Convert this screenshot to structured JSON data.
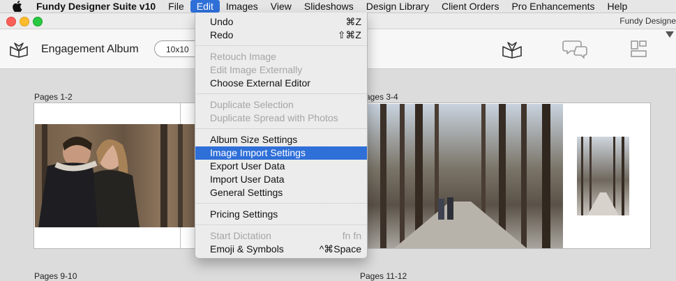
{
  "menubar": {
    "app_name": "Fundy Designer Suite v10",
    "items": [
      "File",
      "Edit",
      "Images",
      "View",
      "Slideshows",
      "Design Library",
      "Client Orders",
      "Pro Enhancements",
      "Help"
    ],
    "active": "Edit"
  },
  "window": {
    "title": "Fundy Designe"
  },
  "toolbar": {
    "album_title": "Engagement Album",
    "size_value": "10x10",
    "icons": [
      "album-book-icon",
      "chat-bubbles-icon",
      "layout-icon"
    ]
  },
  "spreads": {
    "s1": {
      "label": "Pages 1-2"
    },
    "s2": {
      "label": "Pages 3-4"
    },
    "s3": {
      "label": "Pages 9-10"
    },
    "s4": {
      "label": "Pages 11-12"
    }
  },
  "edit_menu": {
    "items": [
      {
        "label": "Undo",
        "shortcut": "⌘Z",
        "enabled": true
      },
      {
        "label": "Redo",
        "shortcut": "⇧⌘Z",
        "enabled": true
      },
      {
        "label": "Retouch Image",
        "shortcut": "",
        "enabled": false
      },
      {
        "label": "Edit Image Externally",
        "shortcut": "",
        "enabled": false
      },
      {
        "label": "Choose External Editor",
        "shortcut": "",
        "enabled": true
      },
      {
        "label": "Duplicate Selection",
        "shortcut": "",
        "enabled": false
      },
      {
        "label": "Duplicate Spread with Photos",
        "shortcut": "",
        "enabled": false
      },
      {
        "label": "Album Size Settings",
        "shortcut": "",
        "enabled": true
      },
      {
        "label": "Image Import Settings",
        "shortcut": "",
        "enabled": true,
        "selected": true
      },
      {
        "label": "Export User Data",
        "shortcut": "",
        "enabled": true
      },
      {
        "label": "Import User Data",
        "shortcut": "",
        "enabled": true
      },
      {
        "label": "General Settings",
        "shortcut": "",
        "enabled": true
      },
      {
        "label": "Pricing Settings",
        "shortcut": "",
        "enabled": true
      },
      {
        "label": "Start Dictation",
        "shortcut": "fn fn",
        "enabled": false
      },
      {
        "label": "Emoji & Symbols",
        "shortcut": "^⌘Space",
        "enabled": true
      }
    ]
  },
  "colors": {
    "selection": "#2f6fd8",
    "menubar_bg": "#e6e6e6",
    "canvas_bg": "#dcdcdc"
  }
}
